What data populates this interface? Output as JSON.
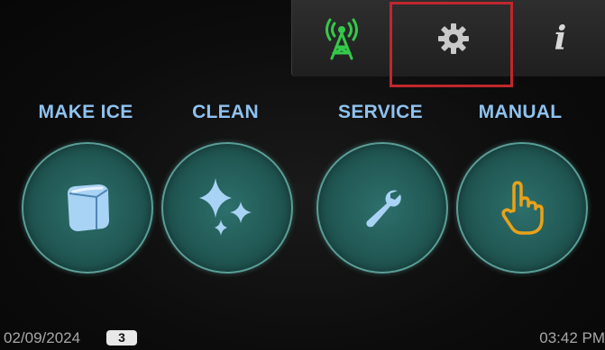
{
  "topbar": {
    "icons": [
      "antenna-icon",
      "gear-icon",
      "info-icon"
    ],
    "info_glyph": "i"
  },
  "modes": [
    {
      "label": "MAKE ICE",
      "icon": "ice-cube-icon"
    },
    {
      "label": "CLEAN",
      "icon": "sparkle-icon"
    },
    {
      "label": "SERVICE",
      "icon": "wrench-icon"
    },
    {
      "label": "MANUAL",
      "icon": "pointing-hand-icon"
    }
  ],
  "status": {
    "date": "02/09/2024",
    "badge_count": "3",
    "time": "03:42 PM"
  },
  "colors": {
    "label": "#8fc2ef",
    "antenna": "#35c94a",
    "manual_icon": "#e8a21a",
    "highlight": "#c0272d",
    "icon_light": "#a9d3f4"
  }
}
